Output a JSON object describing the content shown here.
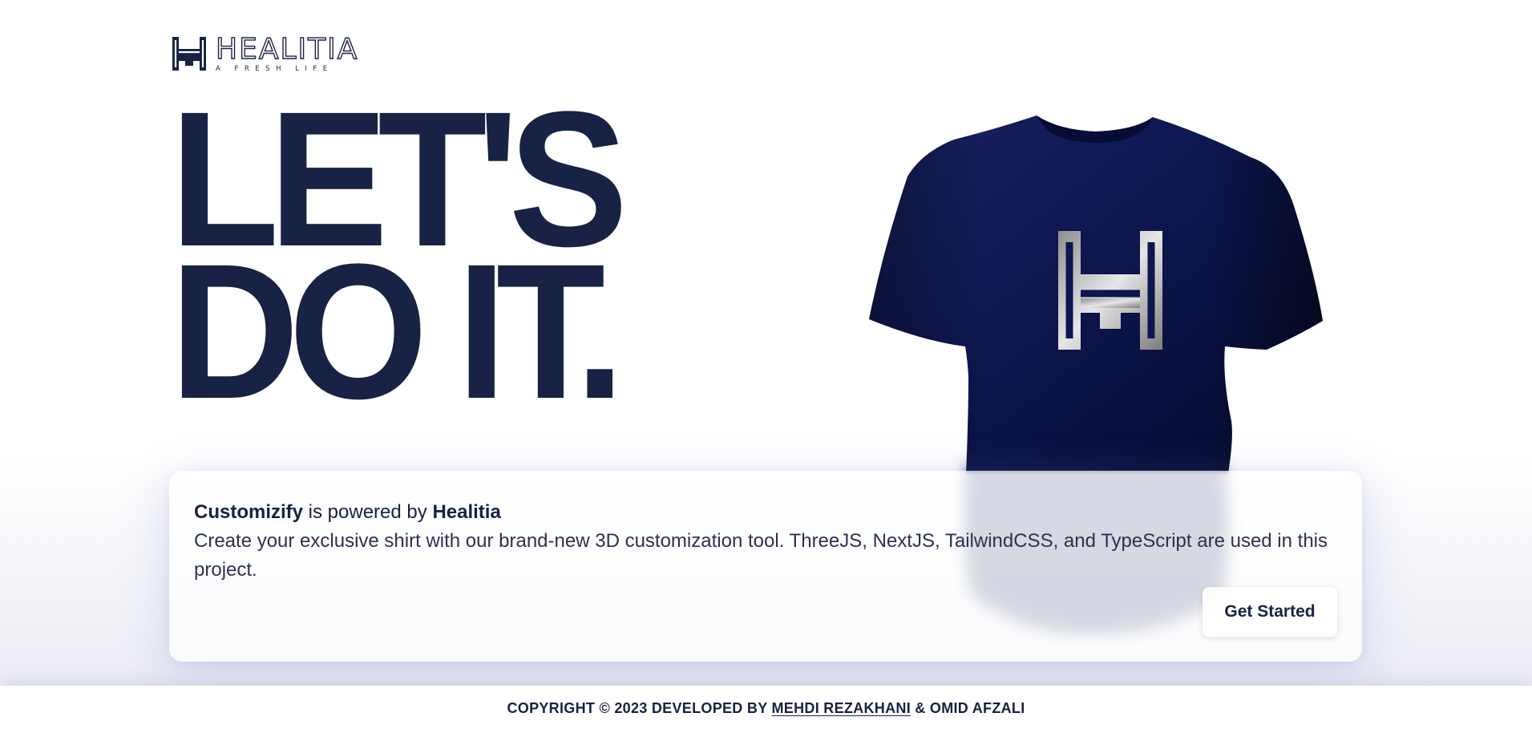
{
  "brand": {
    "name": "HEALITIA",
    "tagline": "A FRESH LIFE"
  },
  "hero": {
    "line1": "LET'S",
    "line2": "DO IT."
  },
  "card": {
    "product_name": "Customizify",
    "powered_text": " is powered by ",
    "company_name": "Healitia",
    "description": "Create your exclusive shirt with our brand-new 3D customization tool. ThreeJS, NextJS, TailwindCSS, and TypeScript are used in this project.",
    "button_label": "Get Started"
  },
  "footer": {
    "prefix": "COPYRIGHT © 2023 DEVELOPED BY ",
    "author1": "MEHDI REZAKHANI",
    "separator": " & ",
    "author2": "OMID AFZALI"
  },
  "colors": {
    "navy": "#172244",
    "shirt": "#0d164f",
    "logo_print": "#c9c9c9",
    "background": "#ffffff"
  },
  "icons": {
    "logo_mark": "healitia-h-icon",
    "shirt_print": "healitia-h-print-icon"
  }
}
